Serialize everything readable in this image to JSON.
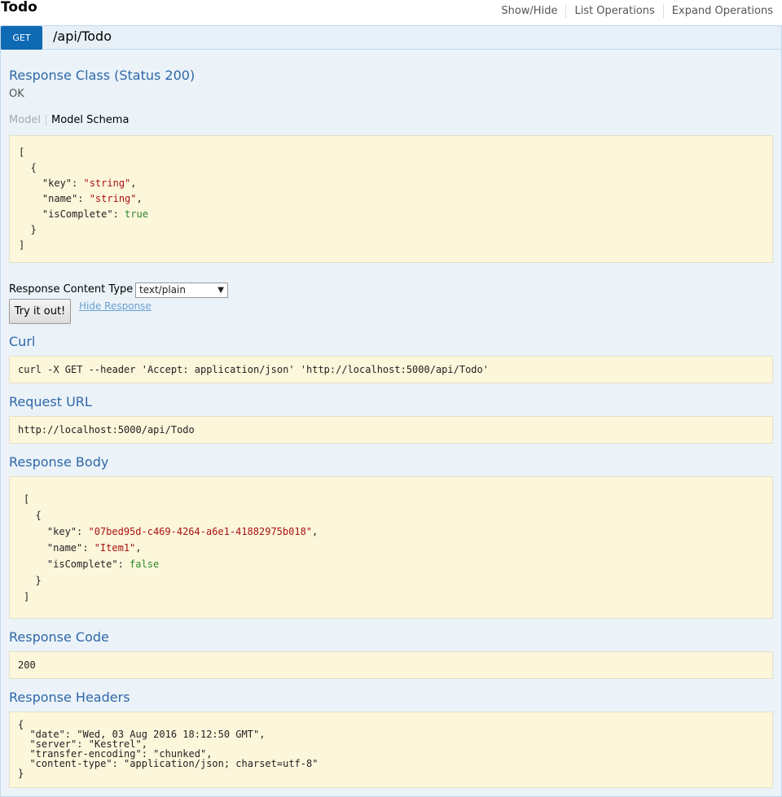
{
  "resource": {
    "title": "Todo",
    "links": [
      "Show/Hide",
      "List Operations",
      "Expand Operations"
    ]
  },
  "operation": {
    "method": "GET",
    "path": "/api/Todo"
  },
  "response_class": {
    "title": "Response Class (Status 200)",
    "status_text": "OK",
    "tabs": {
      "model": "Model",
      "schema": "Model Schema"
    },
    "schema_lines": [
      "[",
      "  {",
      "    \"key\": \"string\",",
      "    \"name\": \"string\",",
      "    \"isComplete\": true",
      "  }",
      "]"
    ]
  },
  "content_type": {
    "label": "Response Content Type",
    "selected": "text/plain"
  },
  "actions": {
    "try_label": "Try it out!",
    "hide_label": "Hide Response"
  },
  "curl": {
    "title": "Curl",
    "command": "curl -X GET --header 'Accept: application/json' 'http://localhost:5000/api/Todo'"
  },
  "request_url": {
    "title": "Request URL",
    "value": "http://localhost:5000/api/Todo"
  },
  "response_body": {
    "title": "Response Body",
    "lines": [
      "[",
      "  {",
      "    \"key\": \"07bed95d-c469-4264-a6e1-41882975b018\",",
      "    \"name\": \"Item1\",",
      "    \"isComplete\": false",
      "  }",
      "]"
    ]
  },
  "response_code": {
    "title": "Response Code",
    "value": "200"
  },
  "response_headers": {
    "title": "Response Headers",
    "lines": [
      "{",
      "  \"date\": \"Wed, 03 Aug 2016 18:12:50 GMT\",",
      "  \"server\": \"Kestrel\",",
      "  \"transfer-encoding\": \"chunked\",",
      "  \"content-type\": \"application/json; charset=utf-8\"",
      "}"
    ]
  },
  "colors": {
    "method_get": "#0f6ab4",
    "section_title": "#2e67a8",
    "code_background": "#fcf6db",
    "operation_background": "#ebf3f9"
  }
}
